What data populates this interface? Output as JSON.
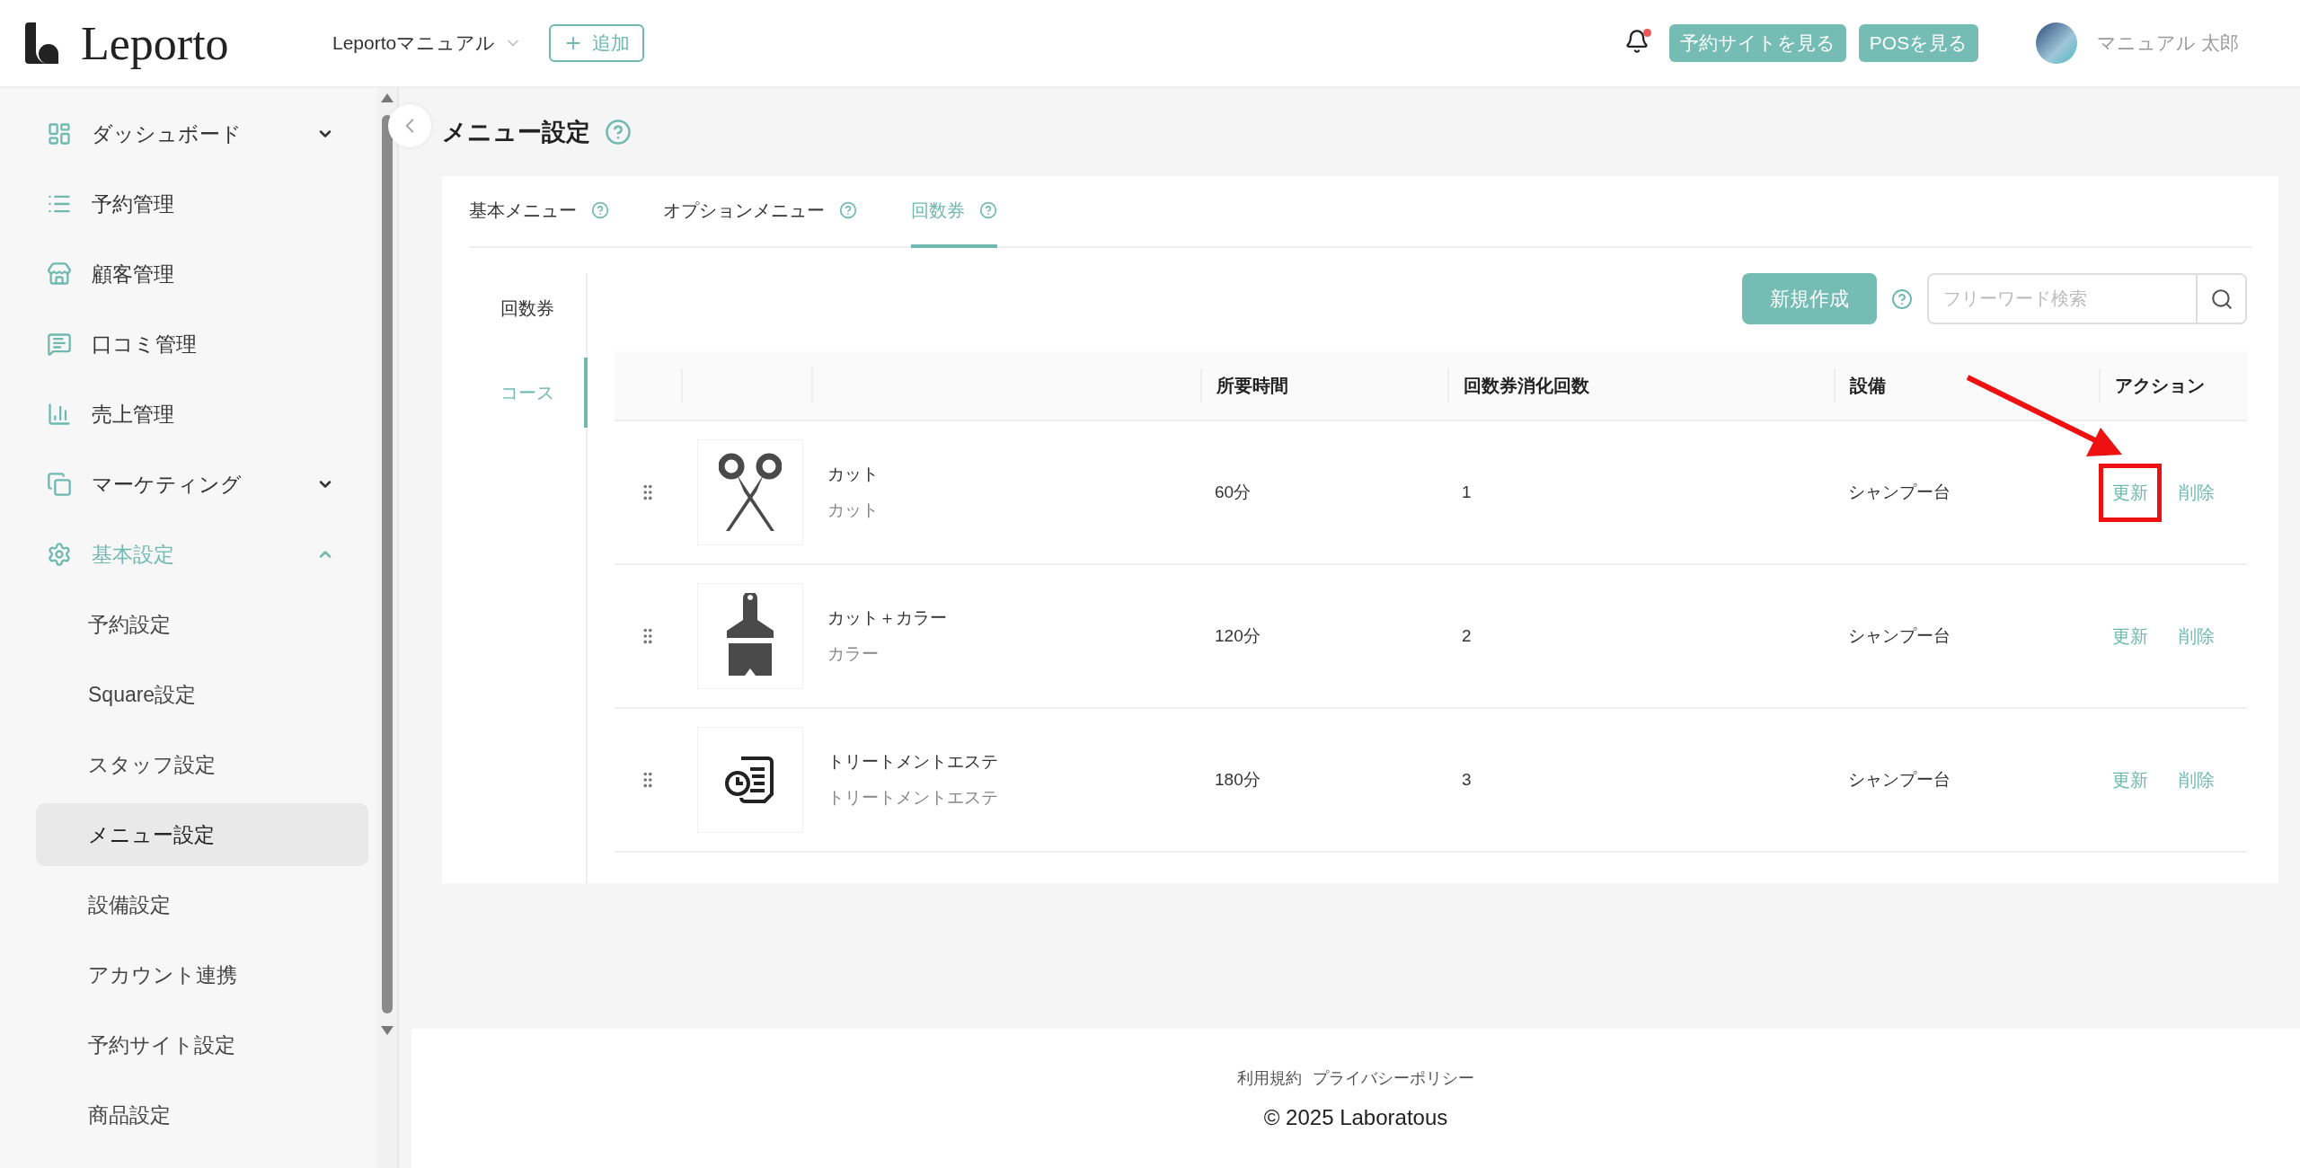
{
  "header": {
    "logo": "Leporto",
    "store_selector": "Leportoマニュアル",
    "add_button": "追加",
    "notification_unread": true,
    "buttons": [
      "予約サイトを見る",
      "POSを見る"
    ],
    "user_name": "マニュアル 太郎"
  },
  "sidebar": {
    "items": [
      {
        "label": "ダッシュボード",
        "expanded": false,
        "selected": false
      },
      {
        "label": "予約管理",
        "selected": false
      },
      {
        "label": "顧客管理",
        "selected": false
      },
      {
        "label": "口コミ管理",
        "selected": false
      },
      {
        "label": "売上管理",
        "selected": false
      },
      {
        "label": "マーケティング",
        "expanded": false,
        "selected": false
      },
      {
        "label": "基本設定",
        "expanded": true,
        "selected": true,
        "children": [
          {
            "label": "予約設定",
            "selected": false
          },
          {
            "label": "Square設定",
            "selected": false
          },
          {
            "label": "スタッフ設定",
            "selected": false
          },
          {
            "label": "メニュー設定",
            "selected": true
          },
          {
            "label": "設備設定",
            "selected": false
          },
          {
            "label": "アカウント連携",
            "selected": false
          },
          {
            "label": "予約サイト設定",
            "selected": false
          },
          {
            "label": "商品設定",
            "selected": false
          }
        ]
      }
    ]
  },
  "page": {
    "title": "メニュー設定"
  },
  "tabs": [
    {
      "label": "基本メニュー",
      "selected": false
    },
    {
      "label": "オプションメニュー",
      "selected": false
    },
    {
      "label": "回数券",
      "selected": true
    }
  ],
  "subnav": [
    {
      "label": "回数券",
      "selected": false
    },
    {
      "label": "コース",
      "selected": true
    }
  ],
  "toolbar": {
    "create_button": "新規作成",
    "search": {
      "placeholder": "フリーワード検索"
    }
  },
  "table": {
    "columns": [
      "所要時間",
      "回数券消化回数",
      "設備",
      "アクション"
    ],
    "rows": [
      {
        "name": "カット",
        "category": "カット",
        "duration": "60分",
        "uses": "1",
        "equipment": "シャンプー台",
        "actions": [
          "更新",
          "削除"
        ],
        "highlighted": true
      },
      {
        "name": "カット＋カラー",
        "category": "カラー",
        "duration": "120分",
        "uses": "2",
        "equipment": "シャンプー台",
        "actions": [
          "更新",
          "削除"
        ],
        "highlighted": false
      },
      {
        "name": "トリートメントエステ",
        "category": "トリートメントエステ",
        "duration": "180分",
        "uses": "3",
        "equipment": "シャンプー台",
        "actions": [
          "更新",
          "削除"
        ],
        "highlighted": false
      }
    ]
  },
  "footer": {
    "links": [
      "利用規約",
      "プライバシーポリシー"
    ],
    "copyright": "© 2025 Laboratous"
  }
}
